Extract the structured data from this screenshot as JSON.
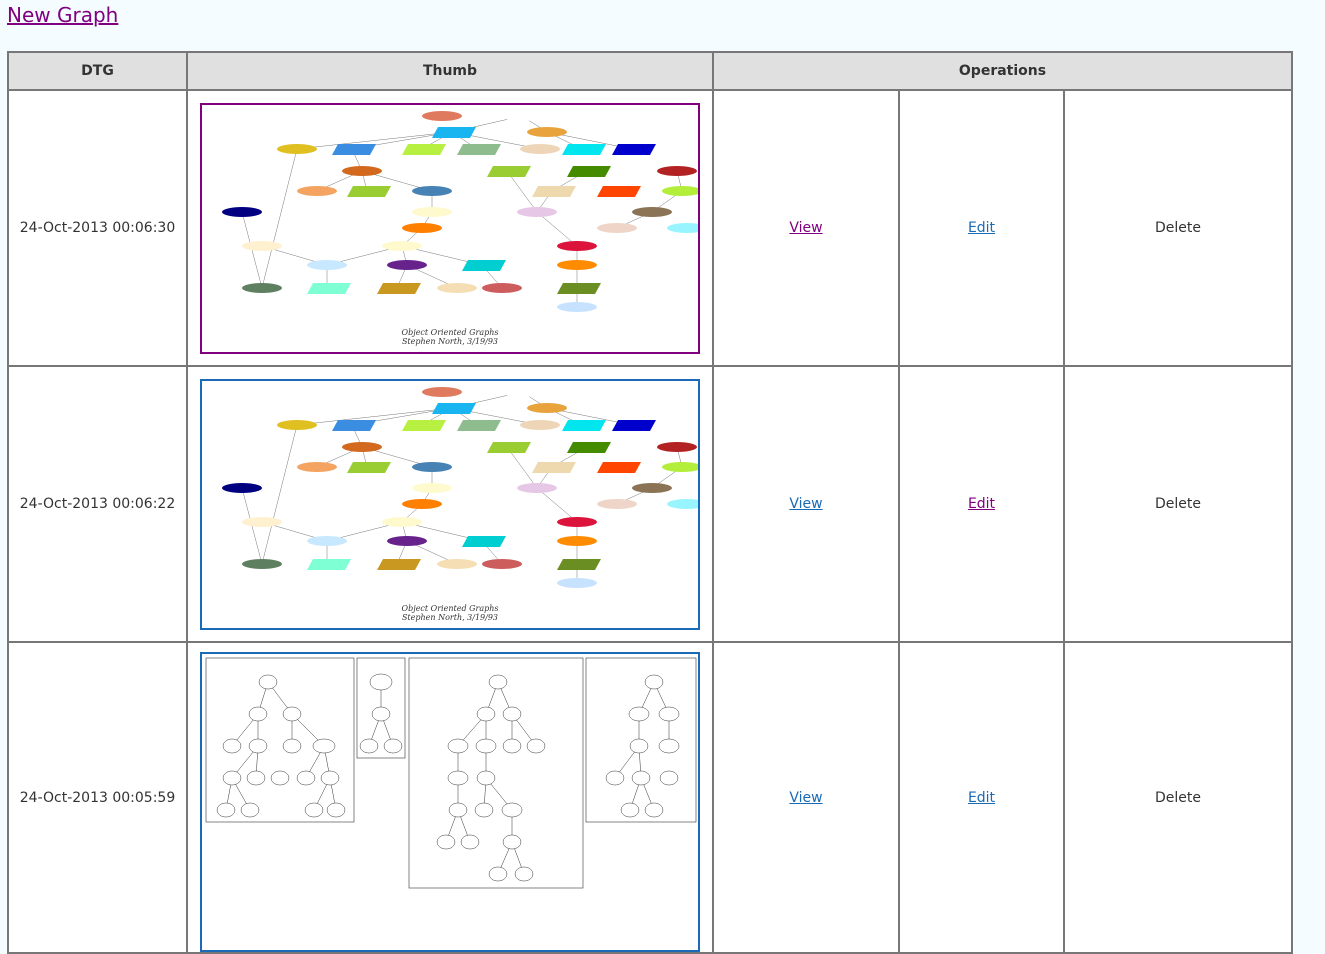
{
  "header": {
    "new_graph_link": "New Graph"
  },
  "table": {
    "columns": {
      "dtg": "DTG",
      "thumb": "Thumb",
      "operations": "Operations"
    },
    "rows": [
      {
        "dtg": "24-Oct-2013 00:06:30",
        "view": "View",
        "edit": "Edit",
        "delete": "Delete",
        "thumb_caption_line1": "Object Oriented Graphs",
        "thumb_caption_line2": "Stephen North, 3/19/93",
        "frame_color": "#800080"
      },
      {
        "dtg": "24-Oct-2013 00:06:22",
        "view": "View",
        "edit": "Edit",
        "delete": "Delete",
        "thumb_caption_line1": "Object Oriented Graphs",
        "thumb_caption_line2": "Stephen North, 3/19/93",
        "frame_color": "#1a6ab5"
      },
      {
        "dtg": "24-Oct-2013 00:05:59",
        "view": "View",
        "edit": "Edit",
        "delete": "Delete",
        "frame_color": "#1a6ab5"
      }
    ]
  },
  "colors": {
    "visited_link": "#800080",
    "link": "#1a6ab5",
    "page_background": "#f5fcff",
    "header_background": "#e0e0e0"
  }
}
